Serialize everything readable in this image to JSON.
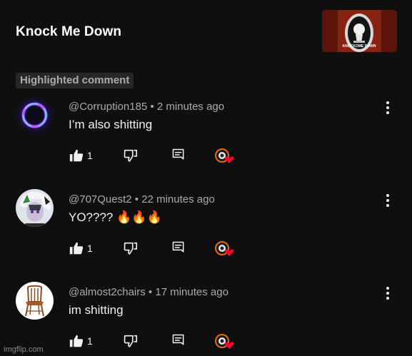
{
  "video": {
    "title": "Knock Me Down",
    "thumbnail_text": "KNOCKOME DOWN"
  },
  "highlight_label": "Highlighted comment",
  "comments": [
    {
      "author": "@Corruption185",
      "time": "2 minutes ago",
      "text": "I’m also shitting",
      "likes": "1",
      "avatar": "neon-ring-avatar"
    },
    {
      "author": "@707Quest2",
      "time": "22 minutes ago",
      "text": "YO???? 🔥🔥🔥",
      "likes": "1",
      "avatar": "anime-character-avatar"
    },
    {
      "author": "@almost2chairs",
      "time": "17 minutes ago",
      "text": "im shitting",
      "likes": "1",
      "avatar": "chair-avatar"
    }
  ],
  "separator": " • ",
  "watermark": "imgflip.com",
  "colors": {
    "background": "#0f0f0f",
    "meta": "#aaaaaa",
    "heart": "#ff0033",
    "creator": "#e06a1a"
  }
}
